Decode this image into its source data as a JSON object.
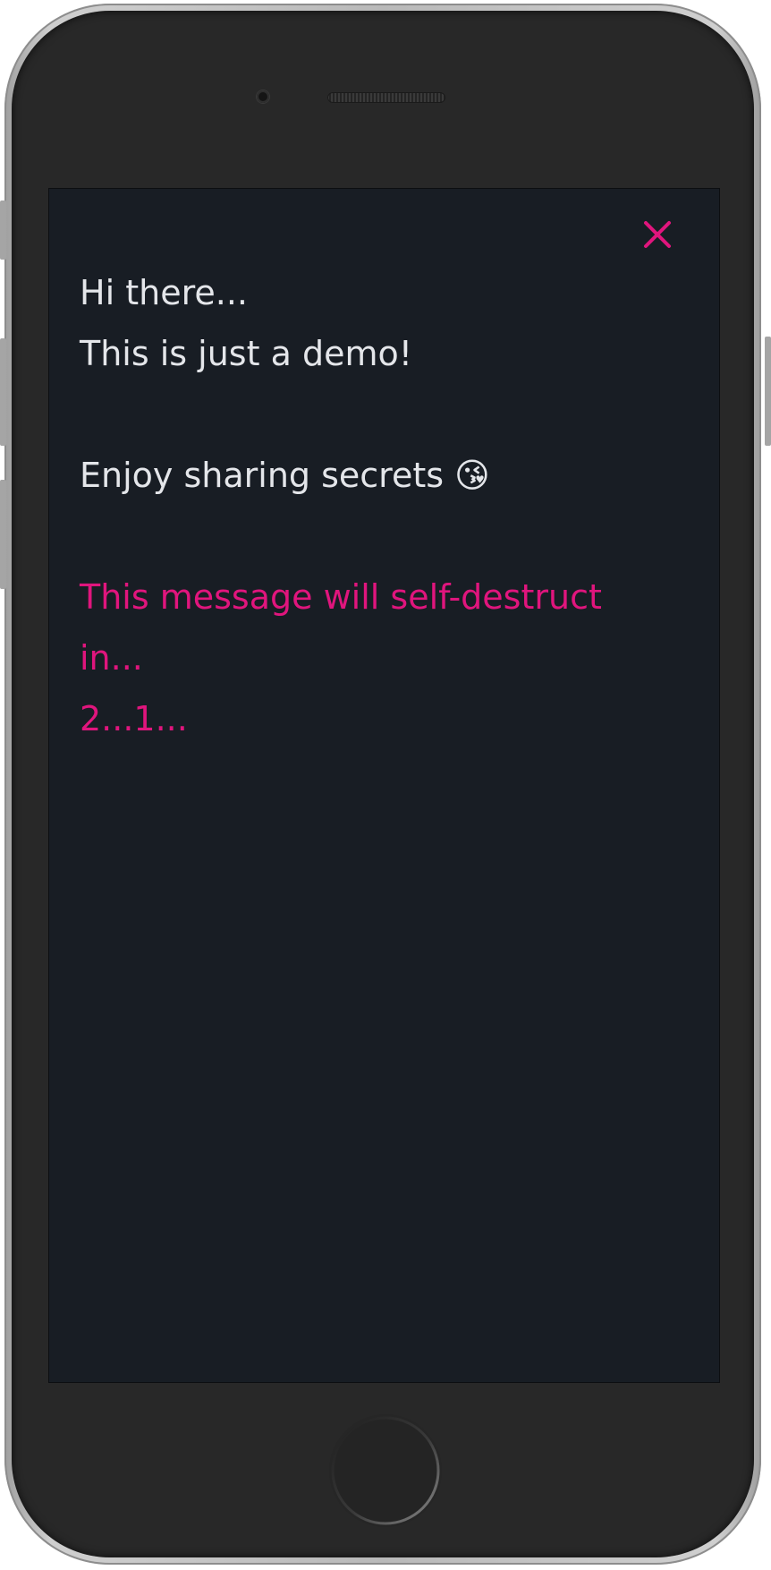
{
  "device": {
    "frame_color": "#282828",
    "screen_background": "#181d24"
  },
  "dialog": {
    "close_icon": "close-icon",
    "accent_color": "#e0157d",
    "text_color": "#e4e6ea",
    "greeting_line1": "Hi there...",
    "greeting_line2": "This is just a demo!",
    "enjoy_text": "Enjoy sharing secrets 😘",
    "warning_line1": "This message will self-destruct",
    "warning_line2": "in...",
    "countdown": "2...1..."
  },
  "home_button": {
    "icon": "home-button-ring"
  }
}
